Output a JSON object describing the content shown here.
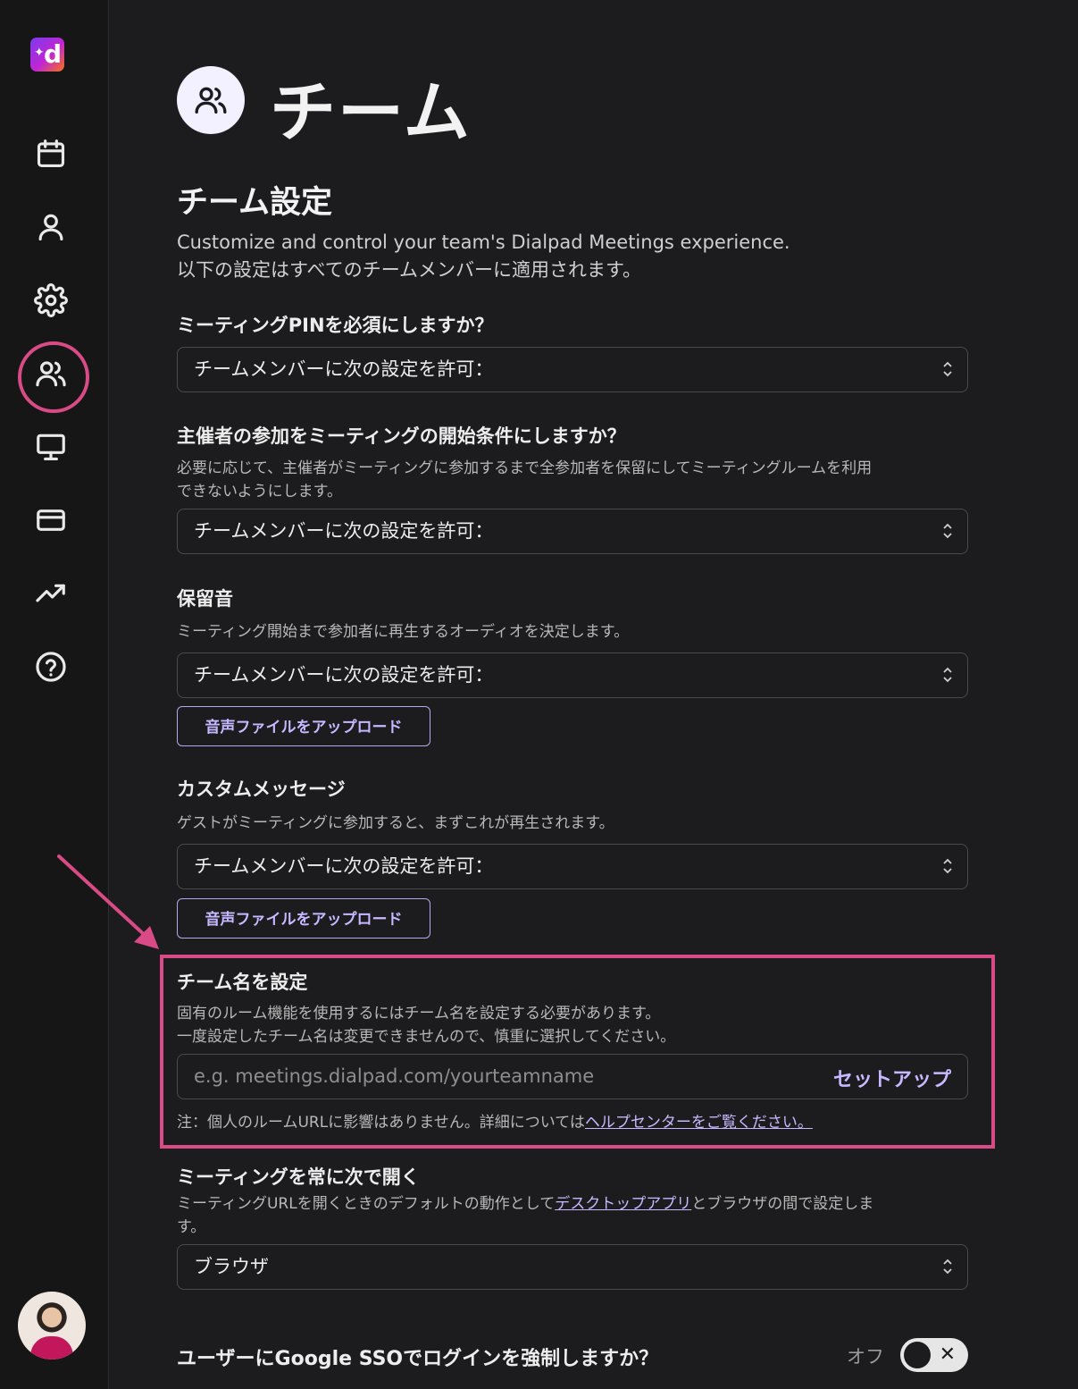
{
  "page": {
    "title": "チーム",
    "section_title": "チーム設定",
    "intro_line1": "Customize and control your team's Dialpad Meetings experience.",
    "intro_line2": "以下の設定はすべてのチームメンバーに適用されます。"
  },
  "settings": {
    "pin": {
      "label": "ミーティングPINを必須にしますか？",
      "value": "チームメンバーに次の設定を許可："
    },
    "host": {
      "label": "主催者の参加をミーティングの開始条件にしますか？",
      "desc_line1": "必要に応じて、主催者がミーティングに参加するまで全参加者を保留にしてミーティングルームを利用",
      "desc_line2": "できないようにします。",
      "value": "チームメンバーに次の設定を許可："
    },
    "hold_music": {
      "label": "保留音",
      "desc": "ミーティング開始まで参加者に再生するオーディオを決定します。",
      "value": "チームメンバーに次の設定を許可：",
      "upload_label": "音声ファイルをアップロード"
    },
    "custom_message": {
      "label": "カスタムメッセージ",
      "desc": "ゲストがミーティングに参加すると、まずこれが再生されます。",
      "value": "チームメンバーに次の設定を許可：",
      "upload_label": "音声ファイルをアップロード"
    },
    "team_name": {
      "label": "チーム名を設定",
      "desc_line1": "固有のルーム機能を使用するにはチーム名を設定する必要があります。",
      "desc_line2": "一度設定したチーム名は変更できませんので、慎重に選択してください。",
      "placeholder": "e.g. meetings.dialpad.com/yourteamname",
      "setup_label": "セットアップ",
      "note_prefix": "注：個人のルームURLに影響はありません。詳細については",
      "note_link": "ヘルプセンターをご覧ください。"
    },
    "open_with": {
      "label": "ミーティングを常に次で開く",
      "desc_prefix": "ミーティングURLを開くときのデフォルトの動作として",
      "desc_link": "デスクトップアプリ",
      "desc_suffix": "とブラウザの間で設定しま",
      "desc_line2": "す。",
      "value": "ブラウザ"
    },
    "sso": {
      "label": "ユーザーにGoogle SSOでログインを強制しますか？",
      "state_label": "オフ",
      "toggle_mark": "✕",
      "enabled": false
    }
  },
  "sidebar": {
    "logo_letter": "d",
    "logo_spark": "✦",
    "items": [
      "calendar-icon",
      "user-icon",
      "gear-icon",
      "users-icon",
      "monitor-icon",
      "credit-card-icon",
      "trending-up-icon",
      "help-icon"
    ],
    "active": "users-icon"
  },
  "colors": {
    "accent": "#c7b8ff",
    "highlight": "#d94b86",
    "background": "#1c1c1e"
  }
}
